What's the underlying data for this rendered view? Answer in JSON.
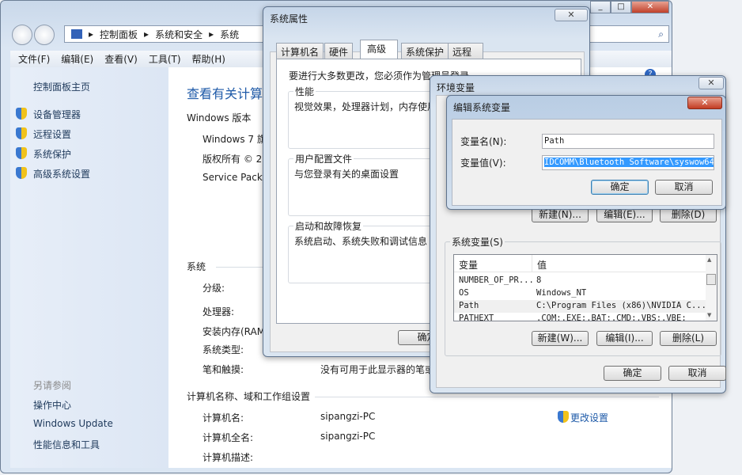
{
  "explorer": {
    "breadcrumb": [
      "控制面板",
      "系统和安全",
      "系统"
    ],
    "menu": [
      "文件(F)",
      "编辑(E)",
      "查看(V)",
      "工具(T)",
      "帮助(H)"
    ],
    "sidebar": {
      "home": "控制面板主页",
      "items": [
        "设备管理器",
        "远程设置",
        "系统保护",
        "高级系统设置"
      ],
      "see_also": "另请参阅",
      "links": [
        "操作中心",
        "Windows Update",
        "性能信息和工具"
      ]
    },
    "main": {
      "title": "查看有关计算",
      "windows_edition": "Windows 版本",
      "edition_rows": [
        "Windows 7 旗",
        "版权所有 © 20",
        "Service Pack"
      ],
      "system_header": "系统",
      "system_labels": [
        "分级:",
        "处理器:",
        "安装内存(RAM",
        "系统类型:",
        "笔和触摸:"
      ],
      "pen_touch_value": "没有可用于此显示器的笔或",
      "computer_header": "计算机名称、域和工作组设置",
      "computer_labels": [
        "计算机名:",
        "计算机全名:",
        "计算机描述:"
      ],
      "computer_name": "sipangzi-PC",
      "computer_full_name": "sipangzi-PC",
      "change_settings": "更改设置"
    }
  },
  "sysprops": {
    "title": "系统属性",
    "tabs": [
      "计算机名",
      "硬件",
      "高级",
      "系统保护",
      "远程"
    ],
    "active_tab": "高级",
    "admin_note": "要进行大多数更改，您必须作为管理员登录。",
    "groups": [
      {
        "label": "性能",
        "desc": "视觉效果，处理器计划，内存使用"
      },
      {
        "label": "用户配置文件",
        "desc": "与您登录有关的桌面设置"
      },
      {
        "label": "启动和故障恢复",
        "desc": "系统启动、系统失败和调试信息"
      }
    ],
    "ok": "确定"
  },
  "envvars": {
    "title": "环境变量",
    "user_buttons": [
      "新建(N)...",
      "编辑(E)...",
      "删除(D)"
    ],
    "system_label": "系统变量(S)",
    "columns": [
      "变量",
      "值"
    ],
    "rows": [
      {
        "name": "NUMBER_OF_PR...",
        "value": "8"
      },
      {
        "name": "OS",
        "value": "Windows_NT"
      },
      {
        "name": "Path",
        "value": "C:\\Program Files (x86)\\NVIDIA C..."
      },
      {
        "name": "PATHEXT",
        "value": ".COM;.EXE;.BAT;.CMD;.VBS;.VBE;"
      }
    ],
    "system_buttons": [
      "新建(W)...",
      "编辑(I)...",
      "删除(L)"
    ],
    "ok": "确定",
    "cancel": "取消"
  },
  "editvar": {
    "title": "编辑系统变量",
    "name_label": "变量名(N):",
    "value_label": "变量值(V):",
    "name_value": "Path",
    "value_value": "IDCOMM\\Bluetooth Software\\syswow64;",
    "ok": "确定",
    "cancel": "取消"
  }
}
